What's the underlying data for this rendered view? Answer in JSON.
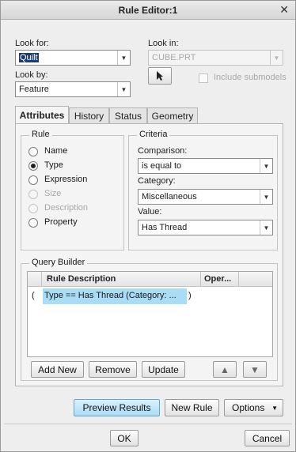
{
  "window": {
    "title": "Rule Editor:1"
  },
  "look_for": {
    "label": "Look for:",
    "value": "Quilt"
  },
  "look_in": {
    "label": "Look in:",
    "value": "CUBE.PRT"
  },
  "look_by": {
    "label": "Look by:",
    "value": "Feature"
  },
  "include_submodels": {
    "label": "Include submodels",
    "checked": false
  },
  "tabs": [
    {
      "label": "Attributes",
      "active": true
    },
    {
      "label": "History"
    },
    {
      "label": "Status"
    },
    {
      "label": "Geometry",
      "disabled": true
    }
  ],
  "rule": {
    "title": "Rule",
    "options": [
      {
        "label": "Name"
      },
      {
        "label": "Type",
        "checked": true
      },
      {
        "label": "Expression"
      },
      {
        "label": "Size",
        "disabled": true
      },
      {
        "label": "Description",
        "disabled": true
      },
      {
        "label": "Property"
      }
    ]
  },
  "criteria": {
    "title": "Criteria",
    "comparison_label": "Comparison:",
    "comparison_value": "is equal to",
    "category_label": "Category:",
    "category_value": "Miscellaneous",
    "value_label": "Value:",
    "value_value": "Has Thread"
  },
  "query_builder": {
    "title": "Query Builder",
    "columns": [
      "Rule Description",
      "Oper..."
    ],
    "rows": [
      {
        "open": "(",
        "description": "Type   ==  Has Thread (Category: ...",
        "close": ")"
      }
    ],
    "add_label": "Add New",
    "remove_label": "Remove",
    "update_label": "Update"
  },
  "actions": {
    "preview_label": "Preview Results",
    "new_rule_label": "New Rule",
    "options_label": "Options",
    "ok_label": "OK",
    "cancel_label": "Cancel"
  },
  "colors": {
    "accent": "#a9dcf5",
    "selection": "#1e3d6e"
  }
}
